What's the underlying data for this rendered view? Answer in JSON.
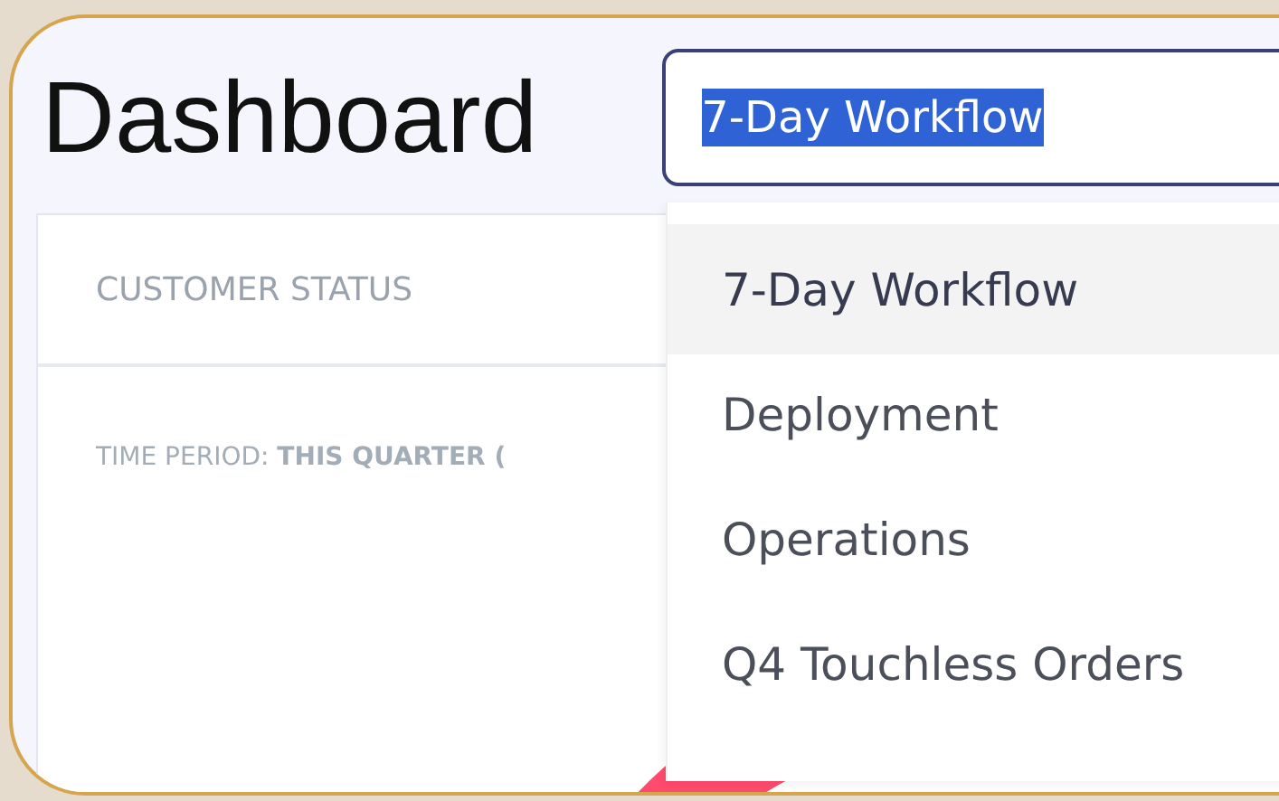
{
  "header": {
    "title": "Dashboard"
  },
  "workflow_select": {
    "value": "7-Day Workflow",
    "text_highlighted": true
  },
  "panel": {
    "title": "CUSTOMER STATUS",
    "time_period": "TIME PERIOD: **THIS QUARTER (**"
  },
  "dropdown": {
    "items": [
      {
        "label": "7-Day Workflow",
        "selected": true
      },
      {
        "label": "Deployment",
        "selected": false
      },
      {
        "label": "Operations",
        "selected": false
      },
      {
        "label": "Q4 Touchless Orders",
        "selected": false
      }
    ]
  }
}
